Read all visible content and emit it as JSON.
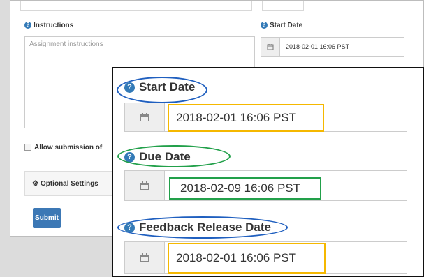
{
  "form": {
    "instructions_label": "Instructions",
    "instructions_placeholder": "Assignment instructions",
    "start_date_label": "Start Date",
    "start_date_value": "2018-02-01 16:06 PST",
    "allow_submission_label": "Allow submission of",
    "optional_settings_label": "Optional Settings",
    "submit_label": "Submit"
  },
  "zoom": {
    "start_date_label": "Start Date",
    "start_date_value": "2018-02-01 16:06 PST",
    "due_date_label": "Due Date",
    "due_date_value": "2018-02-09 16:06 PST",
    "feedback_label": "Feedback Release Date",
    "feedback_value": "2018-02-01 16:06 PST"
  },
  "icons": {
    "help": "?",
    "calendar": "calendar-icon",
    "gear": "gear-icon"
  },
  "colors": {
    "blue_ring": "#1f5fbf",
    "green_ring": "#22a04a",
    "yellow_box": "#f5b800",
    "green_box": "#22a04a"
  }
}
